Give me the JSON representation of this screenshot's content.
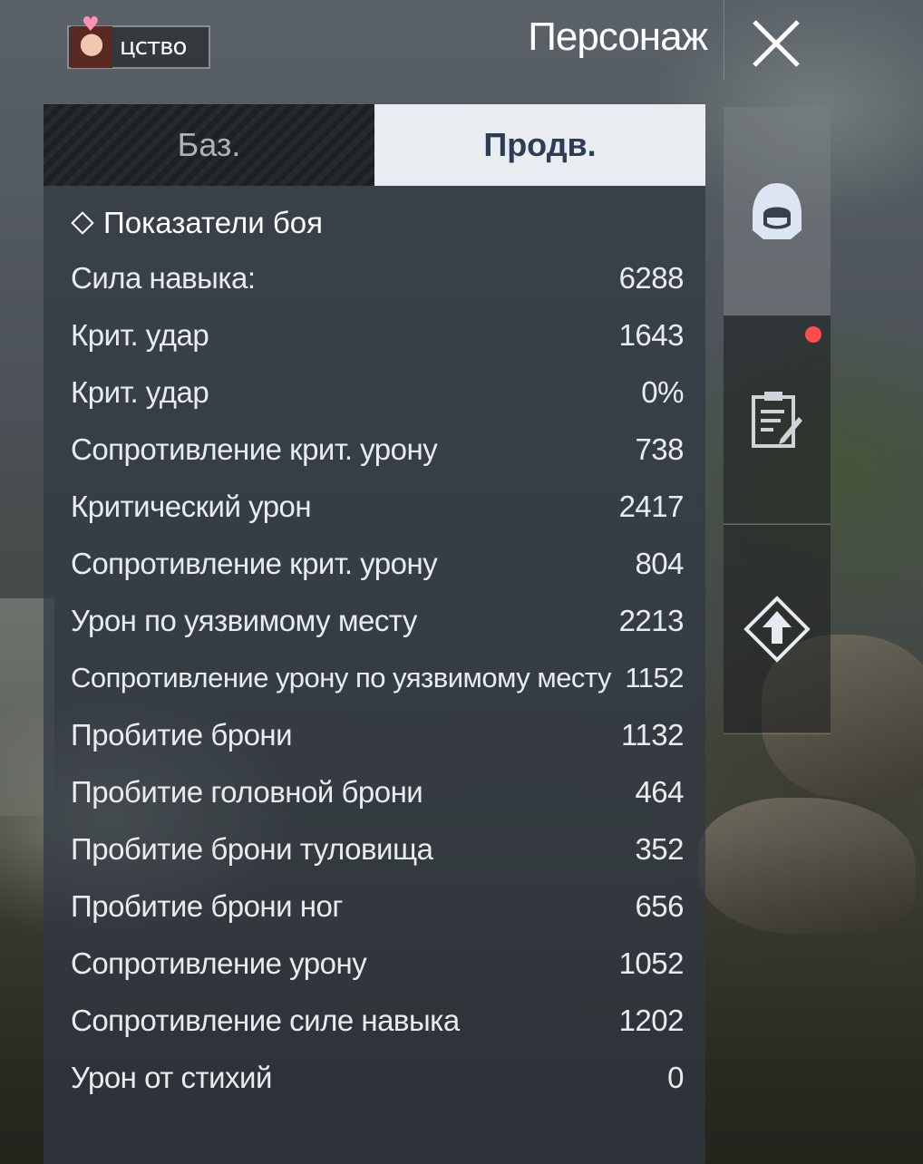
{
  "header": {
    "profile_name": "цство",
    "title": "Персонаж"
  },
  "tabs": [
    {
      "label": "Баз.",
      "active": false
    },
    {
      "label": "Продв.",
      "active": true
    }
  ],
  "section": {
    "title": "Показатели боя"
  },
  "stats": [
    {
      "label": "Сила навыка:",
      "value": "6288"
    },
    {
      "label": "Крит. удар",
      "value": "1643"
    },
    {
      "label": "Крит. удар",
      "value": "0%"
    },
    {
      "label": "Сопротивление крит. урону",
      "value": "738"
    },
    {
      "label": "Критический урон",
      "value": "2417"
    },
    {
      "label": "Сопротивление крит. урону",
      "value": "804"
    },
    {
      "label": "Урон по уязвимому месту",
      "value": "2213"
    },
    {
      "label": "Сопротивление урону по уязвимому месту",
      "value": "1152"
    },
    {
      "label": "Пробитие брони",
      "value": "1132"
    },
    {
      "label": "Пробитие головной брони",
      "value": "464"
    },
    {
      "label": "Пробитие брони туловища",
      "value": "352"
    },
    {
      "label": "Пробитие брони ног",
      "value": "656"
    },
    {
      "label": "Сопротивление урону",
      "value": "1052"
    },
    {
      "label": "Сопротивление силе навыка",
      "value": "1202"
    },
    {
      "label": "Урон от стихий",
      "value": "0"
    }
  ],
  "sidebar": {
    "items": [
      {
        "icon": "hooded-character-icon",
        "active": true
      },
      {
        "icon": "clipboard-edit-icon",
        "active": false,
        "notification": true
      },
      {
        "icon": "upgrade-arrow-icon",
        "active": false
      }
    ]
  },
  "colors": {
    "active_tab_bg": "#e9ecf1",
    "active_tab_text": "#2c3d55",
    "notification": "#ff4d4d"
  }
}
